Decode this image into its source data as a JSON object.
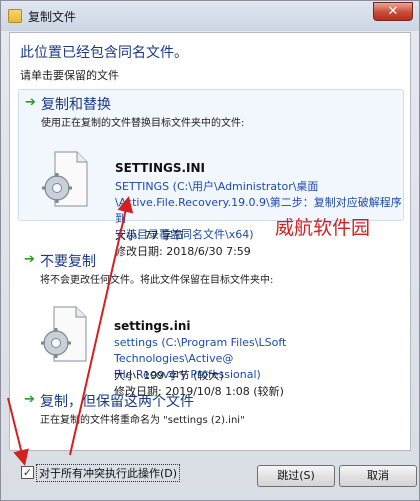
{
  "window": {
    "title": "复制文件",
    "close_glyph": "✕"
  },
  "header": {
    "title": "此位置已经包含同名文件。",
    "subtitle": "请单击要保留的文件"
  },
  "options": [
    {
      "title": "复制和替换",
      "description": "使用正在复制的文件替换目标文件夹中的文件:",
      "file": {
        "name": "SETTINGS.INI",
        "path_lines": [
          "SETTINGS (C:\\用户\\Administrator\\桌面",
          "\\Active.File.Recovery.19.0.9\\第二步：复制对应破解程序到",
          "安装目录覆盖同名文件\\x64)"
        ],
        "size": "大小: 77 字节",
        "modified": "修改日期: 2018/6/30 7:59"
      }
    },
    {
      "title": "不要复制",
      "description": "将不会更改任何文件。将此文件保留在目标文件夹中:",
      "file": {
        "name": "settings.ini",
        "path_lines": [
          "settings (C:\\Program Files\\LSoft Technologies\\Active@",
          "File Recovery Professional)"
        ],
        "size": "大小: 199 字节 (较大)",
        "modified": "修改日期: 2019/10/8 1:08 (较新)"
      }
    },
    {
      "title": "复制，但保留这两个文件",
      "description": "正在复制的文件将重命名为 \"settings (2).ini\""
    }
  ],
  "footer": {
    "checkbox_label": "对于所有冲突执行此操作(D)",
    "checkbox_checked": true,
    "skip_button": "跳过(S)",
    "cancel_button": "取消"
  },
  "watermark": "威航软件园",
  "colors": {
    "accent": "#1c3a84",
    "arrow": "#2f9a28",
    "annotation": "#d42020"
  }
}
